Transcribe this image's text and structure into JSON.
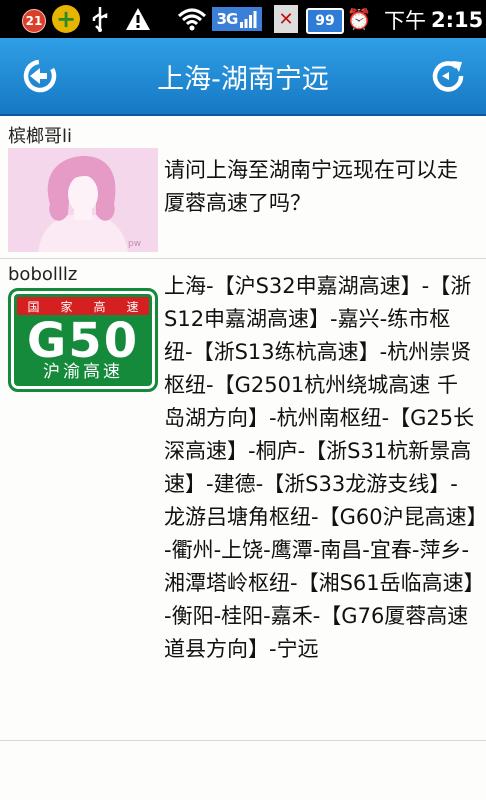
{
  "status_bar": {
    "notification_count": "21",
    "network_type": "3G",
    "battery_level": "99",
    "time_prefix": "下午",
    "time": "2:15",
    "icons": [
      "notification-badge-icon",
      "plus-icon",
      "usb-icon",
      "warning-icon",
      "wifi-icon",
      "3g-signal-icon",
      "no-sim-icon",
      "battery-icon",
      "alarm-icon"
    ]
  },
  "title_bar": {
    "title": "上海-湖南宁远",
    "back_icon": "back-icon",
    "refresh_icon": "refresh-icon",
    "accent_color": "#1e88d2"
  },
  "posts": [
    {
      "username": "槟榔哥li",
      "avatar": "default-female-avatar",
      "text": "请问上海至湖南宁远现在可以走厦蓉高速了吗？"
    },
    {
      "username": "bobolllz",
      "avatar": "g50-highway-sign",
      "avatar_sign": {
        "top_text": [
          "国",
          "家",
          "高",
          "速"
        ],
        "code": "G50",
        "name": "沪渝高速"
      },
      "text": "上海-【沪S32申嘉湖高速】-【浙S12申嘉湖高速】-嘉兴-练市枢纽-【浙S13练杭高速】-杭州崇贤枢纽-【G2501杭州绕城高速 千岛湖方向】-杭州南枢纽-【G25长深高速】-桐庐-【浙S31杭新景高速】-建德-【浙S33龙游支线】-龙游吕塘角枢纽-【G60沪昆高速】-衢州-上饶-鹰潭-南昌-宜春-萍乡-湘潭塔岭枢纽-【湘S61岳临高速】-衡阳-桂阳-嘉禾-【G76厦蓉高速 道县方向】-宁远"
    }
  ]
}
